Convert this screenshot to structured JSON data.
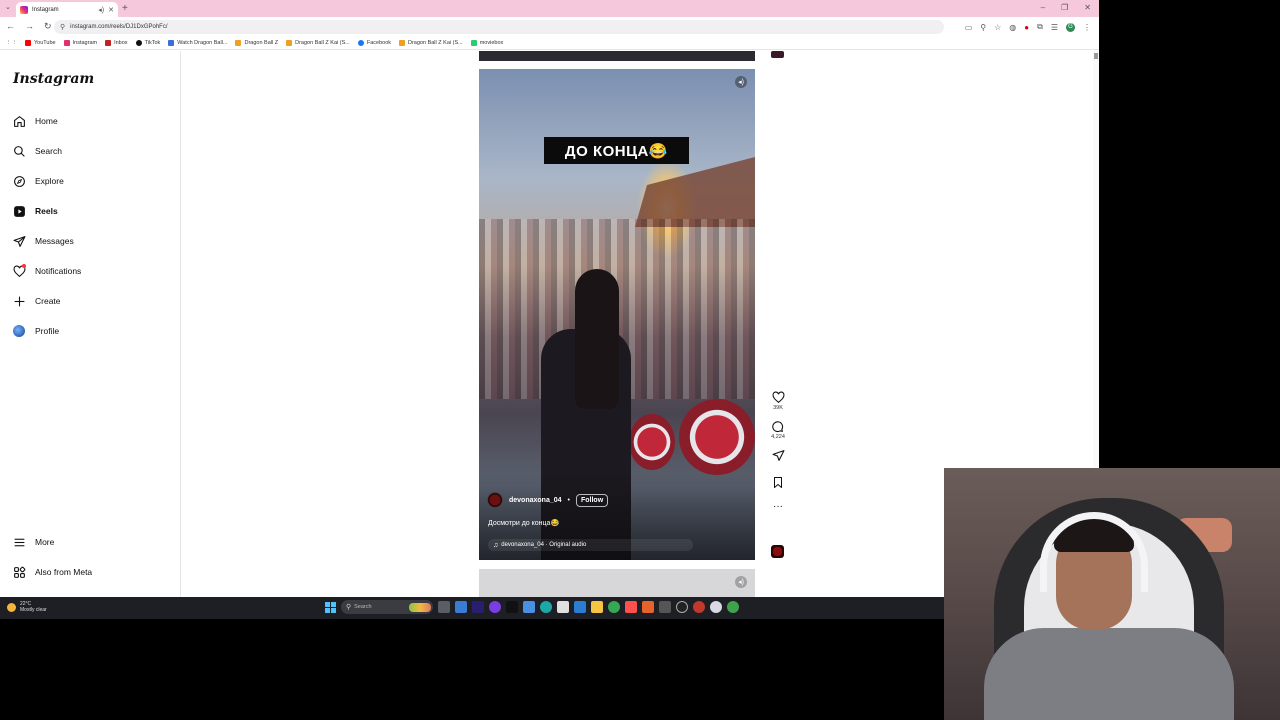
{
  "browser": {
    "tab_title": "Instagram",
    "url": "instagram.com/reels/DJ1DxGPohFc/",
    "bookmarks": [
      "YouTube",
      "Instagram",
      "Inbox",
      "TikTok",
      "Watch Dragon Ball...",
      "Dragon Ball Z",
      "Dragon Ball Z Kai (S...",
      "Facebook",
      "Dragon Ball Z Kai (S...",
      "moviebox"
    ]
  },
  "instagram": {
    "logo": "Instagram",
    "nav": [
      {
        "label": "Home",
        "icon": "home-icon"
      },
      {
        "label": "Search",
        "icon": "search-icon"
      },
      {
        "label": "Explore",
        "icon": "compass-icon"
      },
      {
        "label": "Reels",
        "icon": "reels-icon",
        "active": true
      },
      {
        "label": "Messages",
        "icon": "messenger-icon"
      },
      {
        "label": "Notifications",
        "icon": "heart-icon"
      },
      {
        "label": "Create",
        "icon": "plus-icon"
      },
      {
        "label": "Profile",
        "icon": "profile-avatar"
      }
    ],
    "more_label": "More",
    "meta_label": "Also from Meta"
  },
  "reel": {
    "overlay_text": "ДО КОНЦА😂",
    "username": "devonaxona_04",
    "separator": "•",
    "follow_label": "Follow",
    "description": "Досмотри до конца😂",
    "audio": "devonaxona_04 · Original audio",
    "likes": "39K",
    "comments": "4,224"
  },
  "taskbar": {
    "temperature": "22°C",
    "weather": "Mostly clear",
    "search_placeholder": "Search"
  },
  "colors": {
    "tab_strip": "#f6c8dc",
    "taskbar": "#1e1f24",
    "notification_dot": "#ff3040"
  }
}
